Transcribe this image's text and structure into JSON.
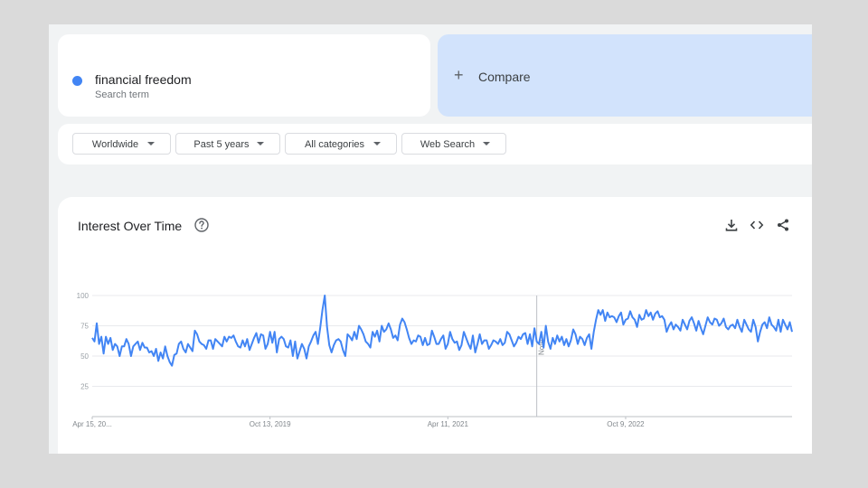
{
  "search_term": {
    "name": "financial freedom",
    "type": "Search term",
    "color": "#4285f4"
  },
  "compare": {
    "label": "Compare",
    "icon": "plus-icon"
  },
  "filters": [
    {
      "label": "Worldwide"
    },
    {
      "label": "Past 5 years"
    },
    {
      "label": "All categories"
    },
    {
      "label": "Web Search"
    }
  ],
  "chart": {
    "title": "Interest Over Time",
    "icons": [
      "help-icon",
      "download-icon",
      "embed-code-icon",
      "share-icon"
    ]
  },
  "chart_data": {
    "type": "line",
    "y_ticks": [
      "100",
      "75",
      "50",
      "25"
    ],
    "ylim": [
      0,
      100
    ],
    "x_tick_labels": [
      "Apr 15, 20...",
      "Oct 13, 2019",
      "Apr 11, 2021",
      "Oct 9, 2022"
    ],
    "x_tick_weeks": [
      0,
      78,
      156,
      234
    ],
    "grid": true,
    "annotation": {
      "label": "Note",
      "week": 195
    },
    "series": [
      {
        "color": "#4285f4",
        "values": [
          65,
          62,
          77,
          60,
          66,
          52,
          66,
          60,
          65,
          55,
          60,
          58,
          50,
          58,
          58,
          64,
          60,
          50,
          58,
          60,
          62,
          55,
          61,
          57,
          57,
          53,
          54,
          50,
          56,
          46,
          53,
          48,
          58,
          50,
          45,
          42,
          51,
          52,
          60,
          62,
          56,
          53,
          60,
          57,
          54,
          71,
          68,
          62,
          60,
          59,
          56,
          63,
          63,
          56,
          64,
          62,
          60,
          58,
          66,
          62,
          66,
          65,
          67,
          62,
          58,
          57,
          63,
          58,
          64,
          55,
          60,
          65,
          69,
          61,
          68,
          67,
          56,
          60,
          70,
          61,
          70,
          53,
          64,
          66,
          64,
          58,
          57,
          63,
          50,
          62,
          48,
          54,
          60,
          56,
          48,
          58,
          62,
          67,
          70,
          60,
          73,
          88,
          100,
          74,
          59,
          53,
          59,
          63,
          64,
          62,
          55,
          50,
          68,
          66,
          63,
          70,
          64,
          75,
          72,
          68,
          62,
          60,
          57,
          70,
          66,
          71,
          62,
          75,
          70,
          72,
          77,
          72,
          65,
          67,
          63,
          76,
          81,
          78,
          72,
          65,
          60,
          63,
          62,
          67,
          66,
          59,
          65,
          59,
          60,
          71,
          66,
          60,
          60,
          64,
          67,
          56,
          60,
          70,
          64,
          61,
          62,
          55,
          59,
          70,
          65,
          60,
          56,
          67,
          53,
          60,
          68,
          60,
          63,
          63,
          56,
          59,
          63,
          62,
          60,
          64,
          59,
          61,
          70,
          68,
          63,
          58,
          61,
          66,
          64,
          68,
          69,
          60,
          68,
          58,
          73,
          62,
          60,
          70,
          57,
          75,
          62,
          56,
          65,
          60,
          67,
          62,
          66,
          59,
          64,
          58,
          63,
          72,
          68,
          60,
          66,
          64,
          59,
          65,
          68,
          56,
          70,
          80,
          88,
          84,
          88,
          79,
          86,
          82,
          83,
          82,
          78,
          83,
          86,
          76,
          80,
          81,
          87,
          82,
          80,
          74,
          84,
          80,
          81,
          88,
          83,
          86,
          80,
          85,
          87,
          82,
          83,
          80,
          70,
          75,
          78,
          72,
          76,
          74,
          71,
          80,
          76,
          72,
          79,
          82,
          77,
          71,
          79,
          73,
          68,
          75,
          82,
          78,
          76,
          81,
          80,
          75,
          77,
          81,
          74,
          72,
          75,
          76,
          73,
          80,
          74,
          70,
          80,
          76,
          72,
          70,
          80,
          74,
          62,
          70,
          76,
          78,
          73,
          82,
          76,
          74,
          71,
          80,
          70,
          80,
          76,
          72,
          78,
          70
        ]
      }
    ]
  }
}
